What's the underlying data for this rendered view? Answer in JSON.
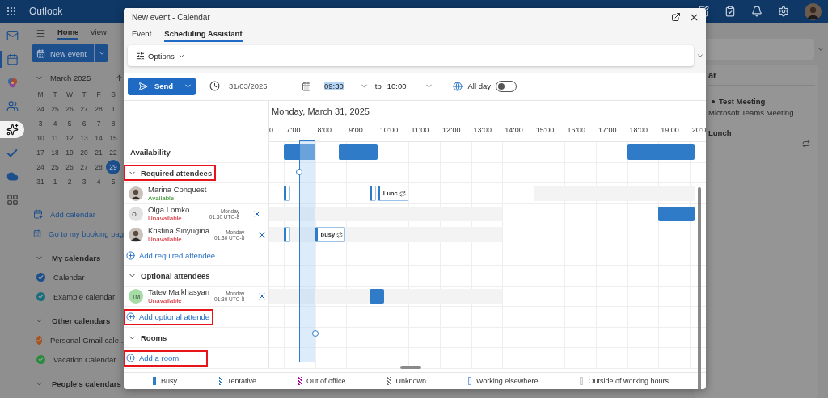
{
  "app": {
    "title": "Outlook"
  },
  "rail": [
    {
      "kind": "mail",
      "selected": false,
      "highlighted": false
    },
    {
      "kind": "calendar",
      "selected": true,
      "highlighted": false
    },
    {
      "kind": "copilot",
      "selected": false,
      "highlighted": false
    },
    {
      "kind": "people",
      "selected": false,
      "highlighted": false
    },
    {
      "kind": "sparkle",
      "selected": false,
      "highlighted": true
    },
    {
      "kind": "todo",
      "selected": false,
      "highlighted": false
    },
    {
      "kind": "cloud",
      "selected": false,
      "highlighted": false
    },
    {
      "kind": "apps",
      "selected": false,
      "highlighted": false
    }
  ],
  "sidebar": {
    "tabs": [
      {
        "label": "Home",
        "selected": true
      },
      {
        "label": "View",
        "selected": false
      }
    ],
    "new_event": "New event",
    "mini_calendar": {
      "title": "March 2025",
      "weekdays": [
        "M",
        "T",
        "W",
        "T",
        "F",
        "S"
      ],
      "weeks": [
        [
          {
            "day": "24",
            "selected": false
          },
          {
            "day": "25",
            "selected": false
          },
          {
            "day": "26",
            "selected": false
          },
          {
            "day": "27",
            "selected": false
          },
          {
            "day": "28",
            "selected": false
          },
          {
            "day": "1",
            "selected": false
          }
        ],
        [
          {
            "day": "3",
            "selected": false
          },
          {
            "day": "4",
            "selected": false
          },
          {
            "day": "5",
            "selected": false
          },
          {
            "day": "6",
            "selected": false
          },
          {
            "day": "7",
            "selected": false
          },
          {
            "day": "8",
            "selected": false
          }
        ],
        [
          {
            "day": "10",
            "selected": false
          },
          {
            "day": "11",
            "selected": false
          },
          {
            "day": "12",
            "selected": false
          },
          {
            "day": "13",
            "selected": false
          },
          {
            "day": "14",
            "selected": false
          },
          {
            "day": "15",
            "selected": false
          }
        ],
        [
          {
            "day": "17",
            "selected": false
          },
          {
            "day": "18",
            "selected": false
          },
          {
            "day": "19",
            "selected": false
          },
          {
            "day": "20",
            "selected": false
          },
          {
            "day": "21",
            "selected": false
          },
          {
            "day": "22",
            "selected": false
          }
        ],
        [
          {
            "day": "24",
            "selected": false
          },
          {
            "day": "25",
            "selected": false
          },
          {
            "day": "26",
            "selected": false
          },
          {
            "day": "27",
            "selected": false
          },
          {
            "day": "28",
            "selected": false
          },
          {
            "day": "29",
            "selected": true
          }
        ],
        [
          {
            "day": "31",
            "selected": false
          },
          {
            "day": "1",
            "selected": false
          },
          {
            "day": "2",
            "selected": false
          },
          {
            "day": "3",
            "selected": false
          },
          {
            "day": "4",
            "selected": false
          },
          {
            "day": "5",
            "selected": false
          }
        ]
      ]
    },
    "links": [
      {
        "kind": "add-calendar",
        "label": "Add calendar"
      },
      {
        "kind": "booking",
        "label": "Go to my booking pag"
      }
    ],
    "groups": [
      {
        "title": "My calendars",
        "expanded": true,
        "items": [
          {
            "label": "Calendar",
            "color": "#1d4f8c"
          },
          {
            "label": "Example calendar",
            "color": "#1a6e7e"
          }
        ]
      },
      {
        "title": "Other calendars",
        "expanded": true,
        "items": [
          {
            "label": "Personal Gmail cale...",
            "color": "#a8521e"
          },
          {
            "label": "Vacation Calendar",
            "color": "#2a8a3e"
          }
        ]
      },
      {
        "title": "People's calendars",
        "expanded": true
      }
    ]
  },
  "right_pane": {
    "heading": "ar",
    "events": [
      {
        "title": "Test Meeting",
        "subtitle": "Microsoft Teams Meeting",
        "bullet": true,
        "recurring": false
      },
      {
        "title": "Lunch",
        "bullet": false,
        "recurring": true
      }
    ]
  },
  "dialog": {
    "title": "New event - Calendar",
    "tabs": [
      {
        "label": "Event",
        "selected": false
      },
      {
        "label": "Scheduling Assistant",
        "selected": true
      }
    ],
    "options": "Options",
    "toolbar": {
      "send": "Send",
      "date": "31/03/2025",
      "start": {
        "value": "09:30",
        "selected": true
      },
      "to": "to",
      "end": {
        "value": "10:00",
        "selected": false
      },
      "all_day": {
        "label": "All day",
        "on": false
      }
    },
    "schedule": {
      "date_heading": "Monday, March 31, 2025",
      "hours": [
        "0",
        "7:00",
        "8:00",
        "9:00",
        "10:00",
        "11:00",
        "12:00",
        "13:00",
        "14:00",
        "15:00",
        "16:00",
        "17:00",
        "18:00",
        "19:00",
        "20:0"
      ],
      "rows": [
        {
          "kind": "availability",
          "label": "Availability",
          "blocks": [
            {
              "kind": "busy"
            },
            {
              "kind": "busy"
            },
            {
              "kind": "busy"
            }
          ]
        },
        {
          "kind": "section",
          "label": "Required attendees",
          "expanded": true,
          "highlighted": true
        },
        {
          "kind": "attendee",
          "name": "Marina Conquest",
          "status": "Available",
          "available": true,
          "avatar": {
            "kind": "photo"
          },
          "blocks": [
            {
              "kind": "tentative"
            },
            {
              "kind": "tentative"
            },
            {
              "kind": "tentative",
              "label": "Lunc",
              "recurring": true
            },
            {
              "kind": "outside"
            }
          ]
        },
        {
          "kind": "attendee",
          "name": "Olga Lomko",
          "status": "Unavailable",
          "available": false,
          "day": "Monday",
          "time": "01:30 UTC-8",
          "avatar": {
            "kind": "initials",
            "initials": "OL",
            "color": "#e1e1e1"
          },
          "blocks": [
            {
              "kind": "outside"
            },
            {
              "kind": "busy"
            }
          ]
        },
        {
          "kind": "attendee",
          "name": "Kristina Sinyugina",
          "status": "Unavailable",
          "available": false,
          "day": "Monday",
          "time": "01:30 UTC-8",
          "avatar": {
            "kind": "photo"
          },
          "blocks": [
            {
              "kind": "outside"
            },
            {
              "kind": "tentative"
            },
            {
              "kind": "tentative",
              "label": "busy",
              "recurring": true
            }
          ]
        },
        {
          "kind": "add",
          "label": "Add required attendee",
          "highlighted": false
        },
        {
          "kind": "section",
          "label": "Optional attendees",
          "expanded": true,
          "highlighted": false
        },
        {
          "kind": "attendee",
          "name": "Tatev Malkhasyan",
          "status": "Unavailable",
          "available": false,
          "day": "Monday",
          "time": "01:30 UTC-8",
          "avatar": {
            "kind": "initials",
            "initials": "TM",
            "color": "#a6dca6"
          },
          "blocks": [
            {
              "kind": "outside"
            },
            {
              "kind": "busy"
            }
          ]
        },
        {
          "kind": "add",
          "label": "Add optional attende",
          "highlighted": true
        },
        {
          "kind": "section",
          "label": "Rooms",
          "expanded": true,
          "highlighted": false
        },
        {
          "kind": "add",
          "label": "Add a room",
          "highlighted": true
        }
      ]
    },
    "legend": [
      {
        "kind": "busy",
        "label": "Busy"
      },
      {
        "kind": "tentative",
        "label": "Tentative"
      },
      {
        "kind": "oof",
        "label": "Out of office"
      },
      {
        "kind": "unknown",
        "label": "Unknown"
      },
      {
        "kind": "elsewhere",
        "label": "Working elsewhere"
      },
      {
        "kind": "outside",
        "label": "Outside of working hours"
      }
    ]
  }
}
